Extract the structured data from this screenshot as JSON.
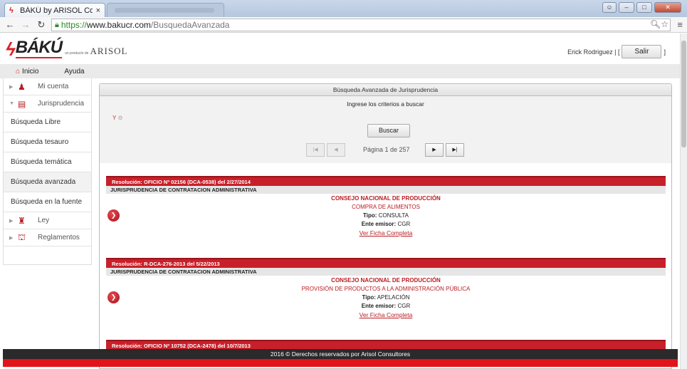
{
  "browser": {
    "tab_title": "BÁKÚ by ARISOL Consulto",
    "tab_close": "×",
    "url_scheme": "https://",
    "url_host": "www.bakucr.com",
    "url_path": "/BusquedaAvanzada"
  },
  "header": {
    "brand": "BÁKÚ",
    "producto": "un producto de",
    "company": "ARISOL",
    "user_text": "Erick Rodriguez |  [",
    "logout_label": "Salir",
    "bracket_close": "]"
  },
  "menubar": {
    "home_label": "Inicio",
    "help_label": "Ayuda"
  },
  "sidebar": {
    "items": [
      {
        "label": "Mi cuenta",
        "icon": "user-icon",
        "type": "group"
      },
      {
        "label": "Jurisprudencia",
        "icon": "gavel-book-icon",
        "type": "group"
      },
      {
        "label": "Búsqueda Libre",
        "type": "link"
      },
      {
        "label": "Búsqueda tesauro",
        "type": "link"
      },
      {
        "label": "Búsqueda temática",
        "type": "link"
      },
      {
        "label": "Búsqueda avanzada",
        "type": "link",
        "active": true
      },
      {
        "label": "Búsqueda en la fuente",
        "type": "link"
      },
      {
        "label": "Ley",
        "icon": "speaker-icon",
        "type": "group"
      },
      {
        "label": "Reglamentos",
        "icon": "building-icon",
        "type": "group"
      }
    ]
  },
  "main": {
    "panel_title": "Búsqueda Avanzada de Jurisprudencia",
    "prompt": "Ingrese los criterios a buscar",
    "y_label": "Y",
    "search_label": "Buscar",
    "page_info": "Página 1 de 257",
    "results": [
      {
        "header": "Resolución:  OFICIO Nº 02156 (DCA-0538)   del  2/27/2014",
        "category": "JURISPRUDENCIA DE CONTRATACION ADMINISTRATIVA",
        "entity": "CONSEJO NACIONAL DE PRODUCCIÓN",
        "subject": "COMPRA DE ALIMENTOS",
        "tipo_label": "Tipo:",
        "tipo": "CONSULTA",
        "emisor_label": "Ente emisor:",
        "emisor": "CGR",
        "link": "Ver Ficha Completa"
      },
      {
        "header": "Resolución:  R-DCA-276-2013   del  5/22/2013",
        "category": "JURISPRUDENCIA DE CONTRATACION ADMINISTRATIVA",
        "entity": "CONSEJO NACIONAL DE PRODUCCIÓN",
        "subject": "PROVISIÓN DE PRODUCTOS A LA ADMINISTRACIÓN PÚBLICA",
        "tipo_label": "Tipo:",
        "tipo": "APELACIÓN",
        "emisor_label": "Ente emisor:",
        "emisor": "CGR",
        "link": "Ver Ficha Completa"
      },
      {
        "header": "Resolución:  OFICIO Nº 10752 (DCA-2478)   del  10/7/2013"
      }
    ]
  },
  "footer": {
    "text": "2016 © Derechos reservados por Arisol Consultores"
  }
}
